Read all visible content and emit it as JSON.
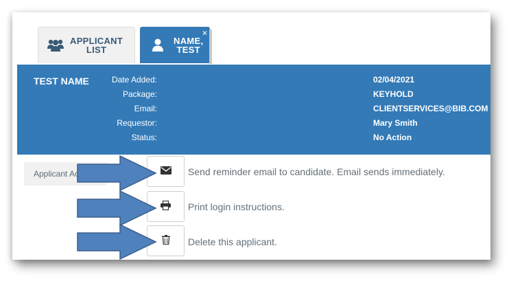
{
  "tabs": [
    {
      "label_line1": "APPLICANT",
      "label_line2": "LIST",
      "icon": "users-icon"
    },
    {
      "label_line1": "NAME,",
      "label_line2": "TEST",
      "icon": "user-icon",
      "close": "×"
    }
  ],
  "applicant": {
    "name": "TEST NAME",
    "info": [
      {
        "label": "Date Added:",
        "value": "02/04/2021"
      },
      {
        "label": "Package:",
        "value": "KEYHOLD"
      },
      {
        "label": "Email:",
        "value": "CLIENTSERVICES@BIB.COM"
      },
      {
        "label": "Requestor:",
        "value": "Mary Smith"
      },
      {
        "label": "Status:",
        "value": "No Action"
      }
    ]
  },
  "panel": {
    "label": "Applicant Actions"
  },
  "actions": [
    {
      "icon": "envelope-icon",
      "text": "Send reminder email to candidate. Email sends immediately."
    },
    {
      "icon": "printer-icon",
      "text": "Print login instructions."
    },
    {
      "icon": "trash-icon",
      "text": "Delete this applicant."
    }
  ],
  "colors": {
    "header_blue": "#337ab7",
    "arrow_fill": "#4f81bd",
    "arrow_stroke": "#3a5f8c",
    "action_text": "#63707a"
  }
}
